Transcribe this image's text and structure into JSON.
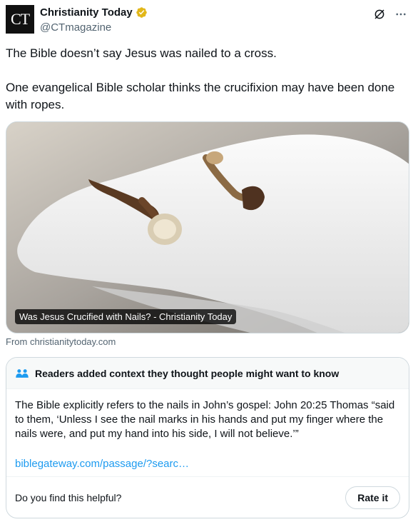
{
  "author": {
    "avatar_text": "CT",
    "name": "Christianity Today",
    "handle": "@CTmagazine",
    "verified_color": "#e2b719"
  },
  "tweet": {
    "paragraphs": [
      "The Bible doesn’t say Jesus was nailed to a cross.",
      "One evangelical Bible scholar thinks the crucifixion may have been done with ropes."
    ]
  },
  "card": {
    "image_description_icon": "gloved-hand-holding-nails-photo",
    "caption": "Was Jesus Crucified with Nails? - Christianity Today",
    "source": "From christianitytoday.com"
  },
  "community_note": {
    "title": "Readers added context they thought people might want to know",
    "body": "The Bible explicitly refers to the nails in John’s gospel: John 20:25 Thomas “said to them, ‘Unless I see the nail marks in his hands and put my finger where the nails were, and put my hand into his side, I will not believe.’”",
    "link": "biblegateway.com/passage/?searc…",
    "helpful_question": "Do you find this helpful?",
    "rate_label": "Rate it",
    "link_color": "#1d9bf0"
  },
  "icons": [
    "grok-icon",
    "more-icon",
    "verified-icon",
    "people-icon"
  ]
}
